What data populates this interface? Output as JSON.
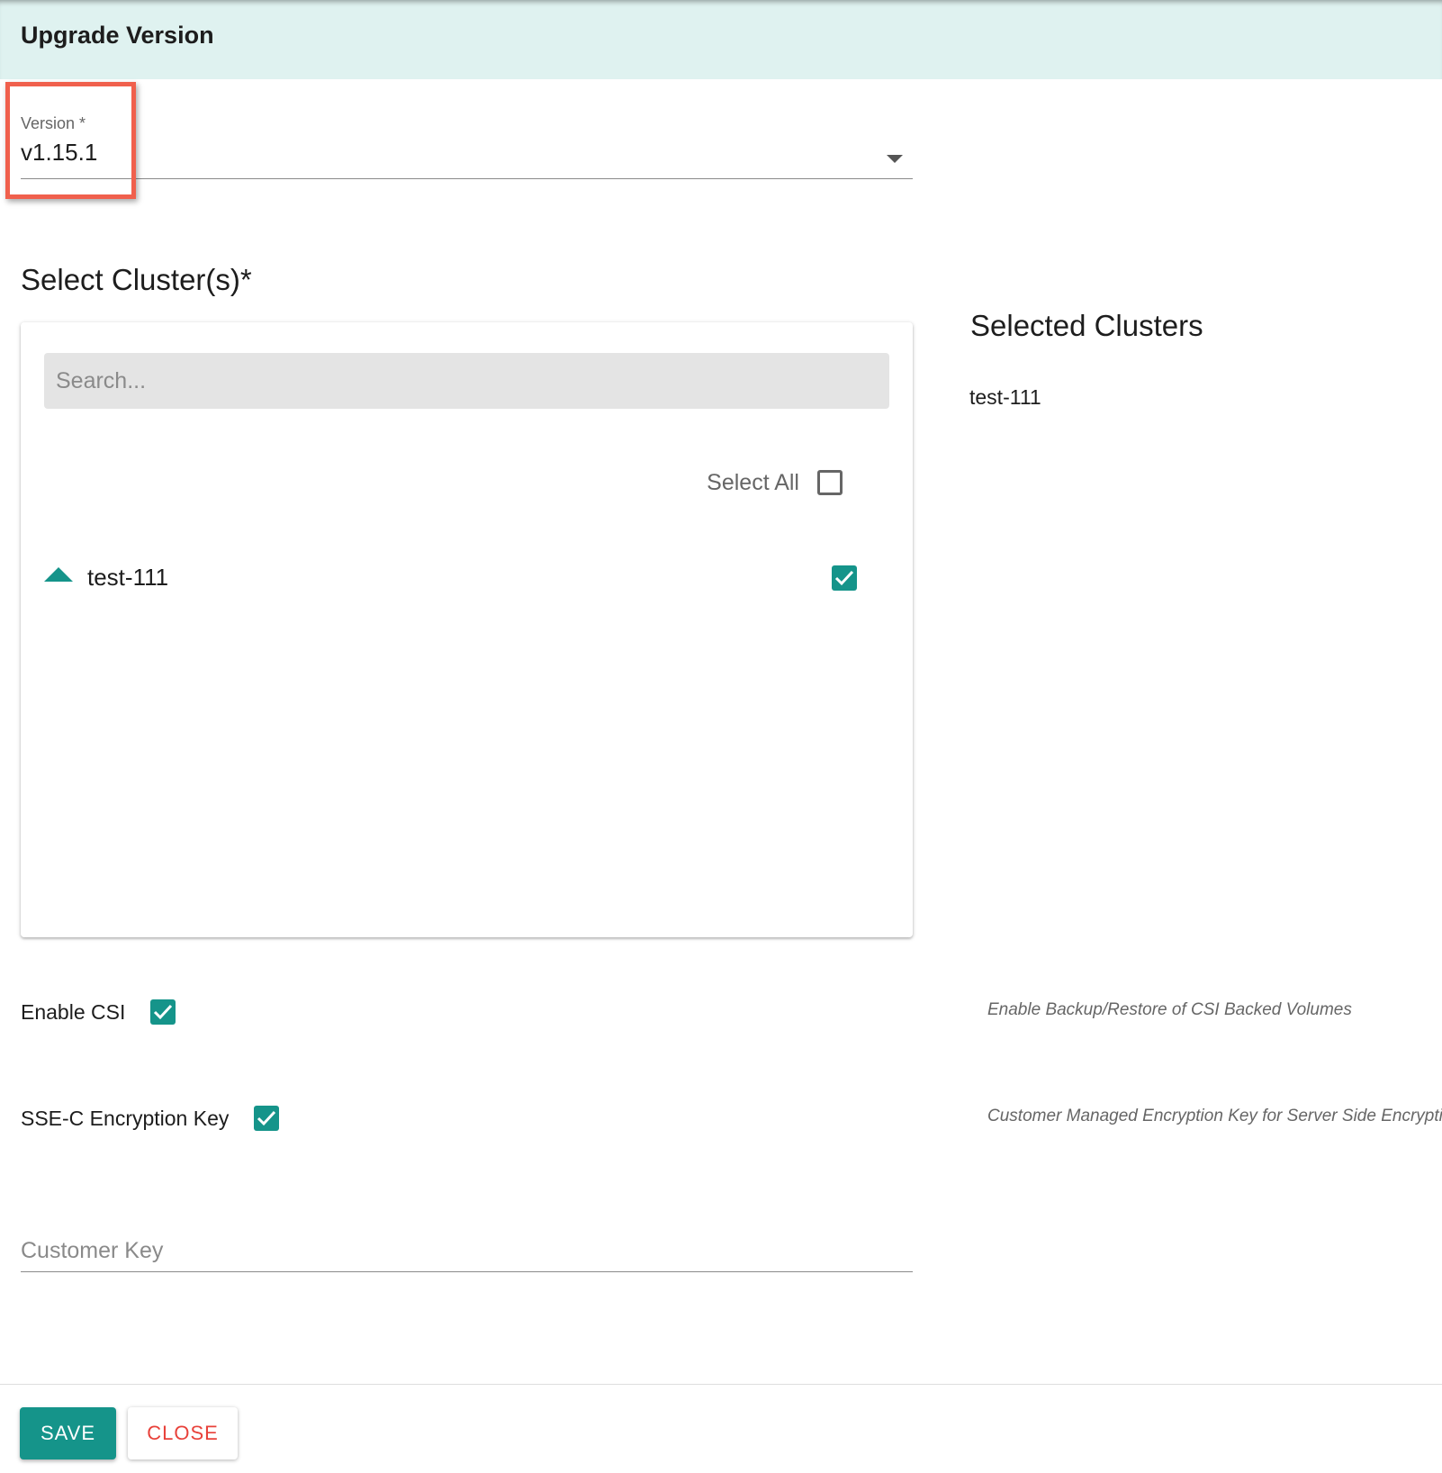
{
  "dialog": {
    "title": "Upgrade Version"
  },
  "version": {
    "label": "Version *",
    "value": "v1.15.1",
    "icon": "chevron-down-icon"
  },
  "clusters": {
    "title": "Select Cluster(s)*",
    "search_placeholder": "Search...",
    "select_all_label": "Select All",
    "select_all_checked": false,
    "items": [
      {
        "name": "test-111",
        "checked": true,
        "expanded": true
      }
    ]
  },
  "selected": {
    "title": "Selected Clusters",
    "items": [
      "test-111"
    ]
  },
  "options": {
    "csi": {
      "label": "Enable CSI",
      "checked": true,
      "description": "Enable Backup/Restore of CSI Backed Volumes"
    },
    "ssec": {
      "label": "SSE-C Encryption Key",
      "checked": true,
      "description": "Customer Managed Encryption Key for Server Side Encryption"
    }
  },
  "customer_key": {
    "placeholder": "Customer Key",
    "value": ""
  },
  "footer": {
    "save_label": "SAVE",
    "close_label": "CLOSE"
  },
  "colors": {
    "accent": "#15948a",
    "header_bg": "#dff2f0",
    "close_text": "#e8413a",
    "highlight_border": "#f0604d"
  }
}
